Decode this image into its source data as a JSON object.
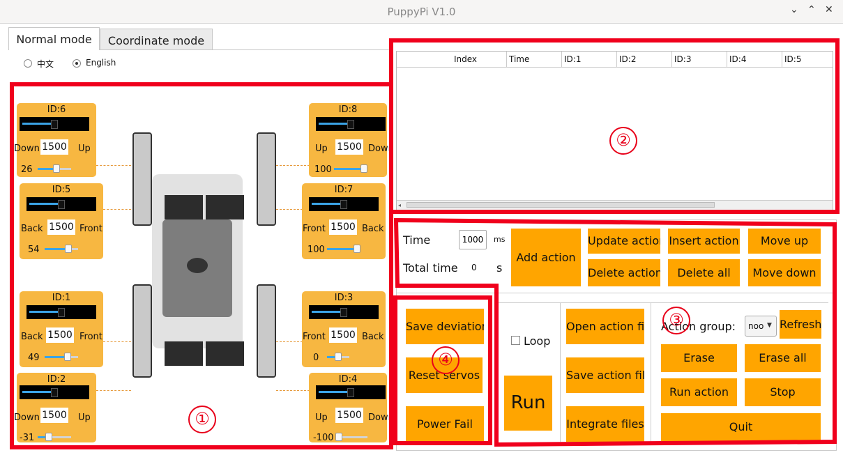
{
  "window": {
    "title": "PuppyPi V1.0",
    "controls": [
      "⌄",
      "⌃",
      "✕"
    ]
  },
  "tabs": [
    {
      "label": "Normal mode"
    },
    {
      "label": "Coordinate mode"
    }
  ],
  "language": {
    "options": [
      {
        "label": "中文",
        "selected": false
      },
      {
        "label": "English",
        "selected": true
      }
    ]
  },
  "markers": {
    "m1": "①",
    "m2": "②",
    "m3": "③",
    "m4": "④"
  },
  "servos": {
    "id6": {
      "name": "ID:6",
      "left_label": "Down",
      "right_label": "Up",
      "value": "1500",
      "position": "26",
      "bar_fill": 0.5,
      "slider_fill": 0.56
    },
    "id8": {
      "name": "ID:8",
      "left_label": "Up",
      "right_label": "Down",
      "value": "1500",
      "position": "100",
      "bar_fill": 0.5,
      "slider_fill": 0.9
    },
    "id5": {
      "name": "ID:5",
      "left_label": "Back",
      "right_label": "Front",
      "value": "1500",
      "position": "54",
      "bar_fill": 0.5,
      "slider_fill": 0.7
    },
    "id7": {
      "name": "ID:7",
      "left_label": "Front",
      "right_label": "Back",
      "value": "1500",
      "position": "100",
      "bar_fill": 0.5,
      "slider_fill": 0.9
    },
    "id1": {
      "name": "ID:1",
      "left_label": "Back",
      "right_label": "Front",
      "value": "1500",
      "position": "49",
      "bar_fill": 0.5,
      "slider_fill": 0.68
    },
    "id3": {
      "name": "ID:3",
      "left_label": "Front",
      "right_label": "Back",
      "value": "1500",
      "position": "0",
      "bar_fill": 0.5,
      "slider_fill": 0.5
    },
    "id2": {
      "name": "ID:2",
      "left_label": "Down",
      "right_label": "Up",
      "value": "1500",
      "position": "-31",
      "bar_fill": 0.5,
      "slider_fill": 0.33
    },
    "id4": {
      "name": "ID:4",
      "left_label": "Up",
      "right_label": "Down",
      "value": "1500",
      "position": "-100",
      "bar_fill": 0.5,
      "slider_fill": 0.0
    }
  },
  "table": {
    "columns": [
      "",
      "Index",
      "Time",
      "ID:1",
      "ID:2",
      "ID:3",
      "ID:4",
      "ID:5"
    ],
    "rows": []
  },
  "action": {
    "time_label": "Time",
    "time_value": "1000",
    "time_unit": "ms",
    "total_label": "Total time",
    "total_value": "0",
    "total_unit": "s",
    "add_action": "Add action",
    "update_action": "Update action",
    "insert_action": "Insert action",
    "move_up": "Move up",
    "delete_action": "Delete action",
    "delete_all": "Delete all",
    "move_down": "Move down"
  },
  "settings": {
    "save_deviation": "Save deviation",
    "reset_servos": "Reset servos",
    "power_fail": "Power Fail"
  },
  "run_panel": {
    "loop_label": "Loop",
    "loop_checked": false,
    "run": "Run"
  },
  "files": {
    "open": "Open action file",
    "save": "Save action file",
    "integrate": "Integrate files"
  },
  "group": {
    "label": "Action group:",
    "selected": "noo",
    "refresh": "Refresh",
    "erase": "Erase",
    "erase_all": "Erase all",
    "run_action": "Run action",
    "stop": "Stop",
    "quit": "Quit"
  },
  "colors": {
    "accent": "#ffa500",
    "panel": "#f7b741",
    "highlight": "#f0001c",
    "slider": "#3ba3e6"
  }
}
